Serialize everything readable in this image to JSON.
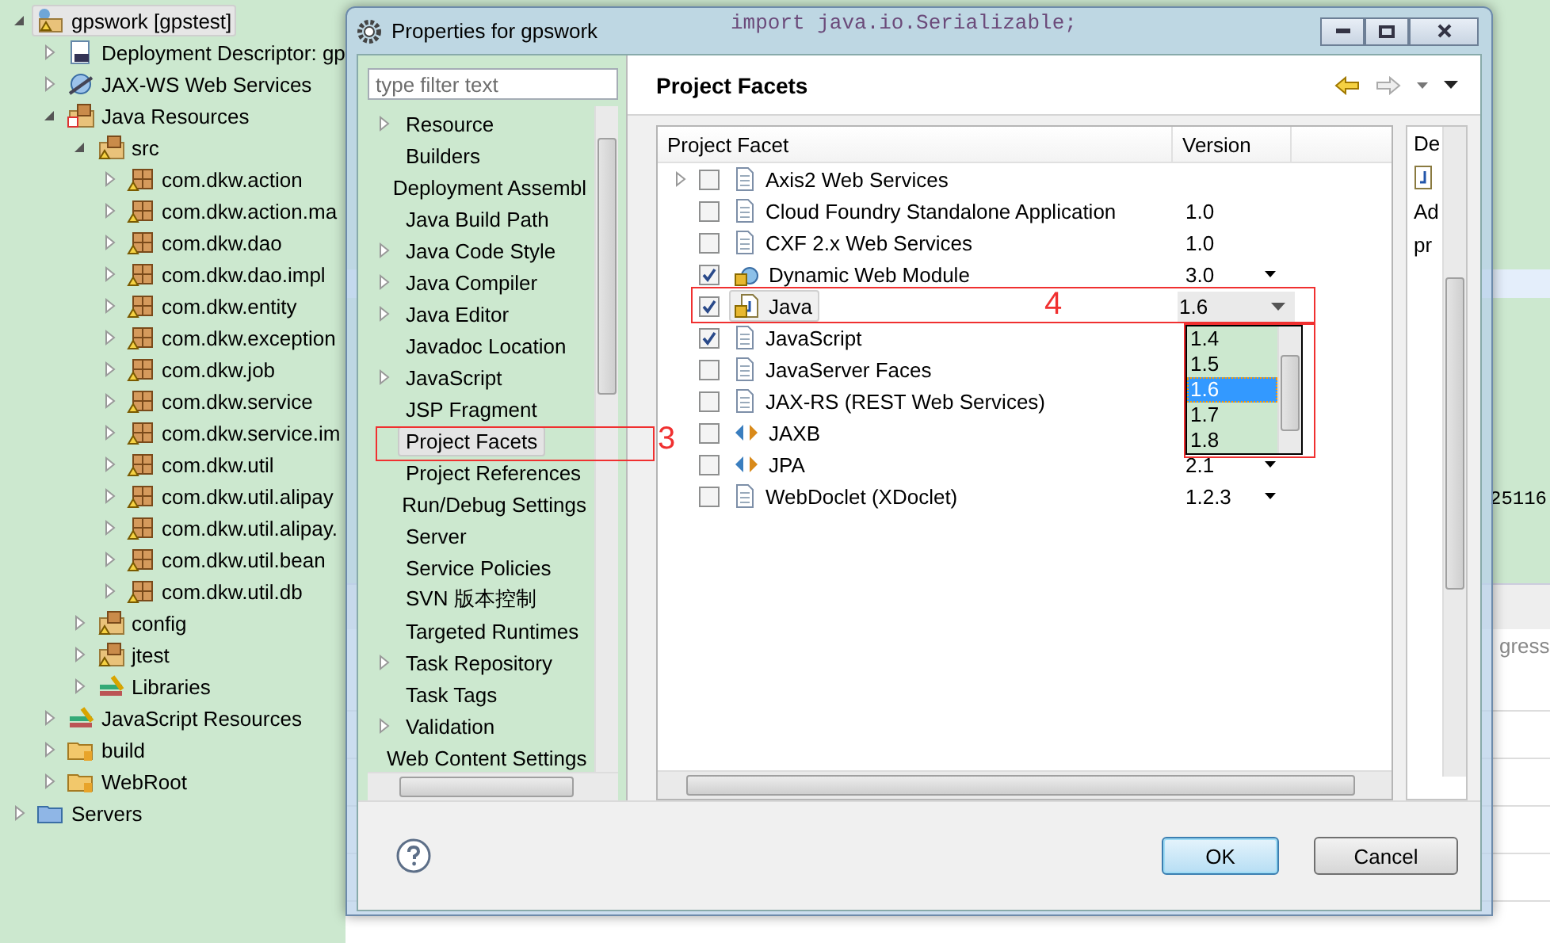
{
  "project_explorer": {
    "items": [
      {
        "label": "gpswork [gpstest]",
        "kind": "project",
        "expanded": true,
        "selected": true,
        "children": [
          {
            "label": "Deployment Descriptor: gp",
            "kind": "descriptor",
            "expanded": false,
            "selected": false
          },
          {
            "label": "JAX-WS Web Services",
            "kind": "webservices",
            "expanded": false,
            "selected": false
          },
          {
            "label": "Java Resources",
            "kind": "resources",
            "expanded": true,
            "selected": false,
            "children": [
              {
                "label": "src",
                "kind": "source",
                "expanded": true,
                "selected": false,
                "children": [
                  {
                    "label": "com.dkw.action",
                    "kind": "package",
                    "expanded": false,
                    "selected": false
                  },
                  {
                    "label": "com.dkw.action.ma",
                    "kind": "package",
                    "expanded": false,
                    "selected": false
                  },
                  {
                    "label": "com.dkw.dao",
                    "kind": "package",
                    "expanded": false,
                    "selected": false
                  },
                  {
                    "label": "com.dkw.dao.impl",
                    "kind": "package",
                    "expanded": false,
                    "selected": false
                  },
                  {
                    "label": "com.dkw.entity",
                    "kind": "package",
                    "expanded": false,
                    "selected": false
                  },
                  {
                    "label": "com.dkw.exception",
                    "kind": "package",
                    "expanded": false,
                    "selected": false
                  },
                  {
                    "label": "com.dkw.job",
                    "kind": "package",
                    "expanded": false,
                    "selected": false
                  },
                  {
                    "label": "com.dkw.service",
                    "kind": "package",
                    "expanded": false,
                    "selected": false
                  },
                  {
                    "label": "com.dkw.service.im",
                    "kind": "package",
                    "expanded": false,
                    "selected": false
                  },
                  {
                    "label": "com.dkw.util",
                    "kind": "package",
                    "expanded": false,
                    "selected": false
                  },
                  {
                    "label": "com.dkw.util.alipay",
                    "kind": "package",
                    "expanded": false,
                    "selected": false
                  },
                  {
                    "label": "com.dkw.util.alipay.",
                    "kind": "package",
                    "expanded": false,
                    "selected": false
                  },
                  {
                    "label": "com.dkw.util.bean",
                    "kind": "package",
                    "expanded": false,
                    "selected": false
                  },
                  {
                    "label": "com.dkw.util.db",
                    "kind": "package",
                    "expanded": false,
                    "selected": false
                  }
                ]
              },
              {
                "label": "config",
                "kind": "source",
                "expanded": false,
                "selected": false
              },
              {
                "label": "jtest",
                "kind": "source",
                "expanded": false,
                "selected": false
              },
              {
                "label": "Libraries",
                "kind": "library",
                "expanded": false,
                "selected": false
              }
            ]
          },
          {
            "label": "JavaScript Resources",
            "kind": "library",
            "expanded": false,
            "selected": false
          },
          {
            "label": "build",
            "kind": "folder",
            "expanded": false,
            "selected": false
          },
          {
            "label": "WebRoot",
            "kind": "folder",
            "expanded": false,
            "selected": false
          }
        ]
      },
      {
        "label": "Servers",
        "kind": "servers",
        "expanded": false,
        "selected": false
      }
    ]
  },
  "editor": {
    "code_line": "import java.io.Serializable;",
    "fragment": "25116",
    "tab_fragment": "gress"
  },
  "dialog": {
    "title": "Properties for gpswork",
    "filter": {
      "placeholder": "type filter text"
    },
    "nav_items": [
      {
        "label": "Resource",
        "expandable": true,
        "selected": false
      },
      {
        "label": "Builders",
        "expandable": false,
        "selected": false
      },
      {
        "label": "Deployment Assembl",
        "expandable": false,
        "selected": false
      },
      {
        "label": "Java Build Path",
        "expandable": false,
        "selected": false
      },
      {
        "label": "Java Code Style",
        "expandable": true,
        "selected": false
      },
      {
        "label": "Java Compiler",
        "expandable": true,
        "selected": false
      },
      {
        "label": "Java Editor",
        "expandable": true,
        "selected": false
      },
      {
        "label": "Javadoc Location",
        "expandable": false,
        "selected": false
      },
      {
        "label": "JavaScript",
        "expandable": true,
        "selected": false
      },
      {
        "label": "JSP Fragment",
        "expandable": false,
        "selected": false
      },
      {
        "label": "Project Facets",
        "expandable": false,
        "selected": true
      },
      {
        "label": "Project References",
        "expandable": false,
        "selected": false
      },
      {
        "label": "Run/Debug Settings",
        "expandable": false,
        "selected": false
      },
      {
        "label": "Server",
        "expandable": false,
        "selected": false
      },
      {
        "label": "Service Policies",
        "expandable": false,
        "selected": false
      },
      {
        "label": "SVN 版本控制",
        "expandable": false,
        "selected": false
      },
      {
        "label": "Targeted Runtimes",
        "expandable": false,
        "selected": false
      },
      {
        "label": "Task Repository",
        "expandable": true,
        "selected": false
      },
      {
        "label": "Task Tags",
        "expandable": false,
        "selected": false
      },
      {
        "label": "Validation",
        "expandable": true,
        "selected": false
      },
      {
        "label": "Web Content Settings",
        "expandable": false,
        "selected": false
      }
    ],
    "page_title": "Project Facets",
    "table": {
      "columns": [
        "Project Facet",
        "Version"
      ],
      "rows": [
        {
          "name": "Axis2 Web Services",
          "kind": "document",
          "expandable": true,
          "checked": false,
          "selected": false
        },
        {
          "name": "Cloud Foundry Standalone Application",
          "kind": "document",
          "expandable": false,
          "checked": false,
          "selected": false,
          "version": {
            "kind": "plain",
            "text": "1.0"
          }
        },
        {
          "name": "CXF 2.x Web Services",
          "kind": "document",
          "expandable": false,
          "checked": false,
          "selected": false,
          "version": {
            "kind": "plain",
            "text": "1.0"
          }
        },
        {
          "name": "Dynamic Web Module",
          "kind": "module",
          "expandable": false,
          "checked": true,
          "selected": false,
          "version": {
            "kind": "dropdown",
            "text": "3.0"
          }
        },
        {
          "name": "Java",
          "kind": "java",
          "expandable": false,
          "checked": true,
          "selected": true,
          "version": {
            "kind": "combo",
            "text": "1.6"
          }
        },
        {
          "name": "JavaScript",
          "kind": "document",
          "expandable": false,
          "checked": true,
          "selected": false
        },
        {
          "name": "JavaServer Faces",
          "kind": "document",
          "expandable": false,
          "checked": false,
          "selected": false
        },
        {
          "name": "JAX-RS (REST Web Services)",
          "kind": "document",
          "expandable": false,
          "checked": false,
          "selected": false
        },
        {
          "name": "JAXB",
          "kind": "binding",
          "expandable": false,
          "checked": false,
          "selected": false
        },
        {
          "name": "JPA",
          "kind": "binding",
          "expandable": false,
          "checked": false,
          "selected": false,
          "version": {
            "kind": "dropdown",
            "text": "2.1"
          }
        },
        {
          "name": "WebDoclet (XDoclet)",
          "kind": "document",
          "expandable": false,
          "checked": false,
          "selected": false,
          "version": {
            "kind": "dropdown",
            "text": "1.2.3"
          }
        }
      ]
    },
    "version_options": [
      {
        "label": "1.4",
        "selected": false
      },
      {
        "label": "1.5",
        "selected": false
      },
      {
        "label": "1.6",
        "selected": true
      },
      {
        "label": "1.7",
        "selected": false
      },
      {
        "label": "1.8",
        "selected": false
      }
    ],
    "details": {
      "tab": "De",
      "lines": [
        "Ad",
        "pr"
      ]
    },
    "buttons": [
      {
        "label": "OK",
        "default": true
      },
      {
        "label": "Cancel",
        "default": false
      }
    ]
  },
  "annotations": [
    {
      "label": "3"
    },
    {
      "label": "4"
    }
  ]
}
